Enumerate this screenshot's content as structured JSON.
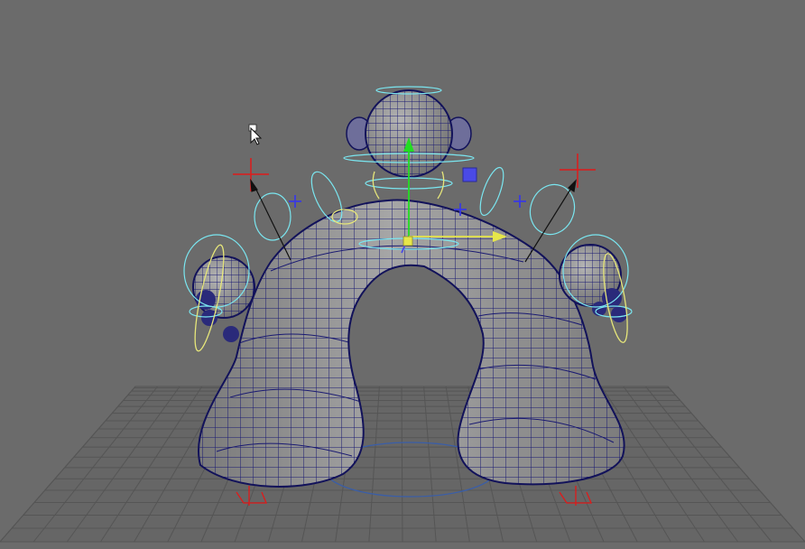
{
  "viewport": {
    "background_color": "#6b6b6b",
    "grid_color": "#5a5a5a",
    "mesh_fill_color": "#9a9a9a",
    "mesh_wire_color": "#1a1a72",
    "control_cyan_color": "#7ae6f0",
    "control_yellow_color": "#e6e67a",
    "ik_target_color": "#e01a1a",
    "locator_color": "#3a3ae0"
  },
  "manipulator": {
    "y_axis_color": "#22dd22",
    "x_axis_color": "#e6e64a",
    "z_axis_color": "#4a4ae6"
  },
  "icons": {
    "cursor": "mouse-pointer-icon",
    "move_tool": "move-manipulator-icon",
    "ik_handle": "ik-handle-cross-icon",
    "locator": "locator-plus-icon"
  }
}
